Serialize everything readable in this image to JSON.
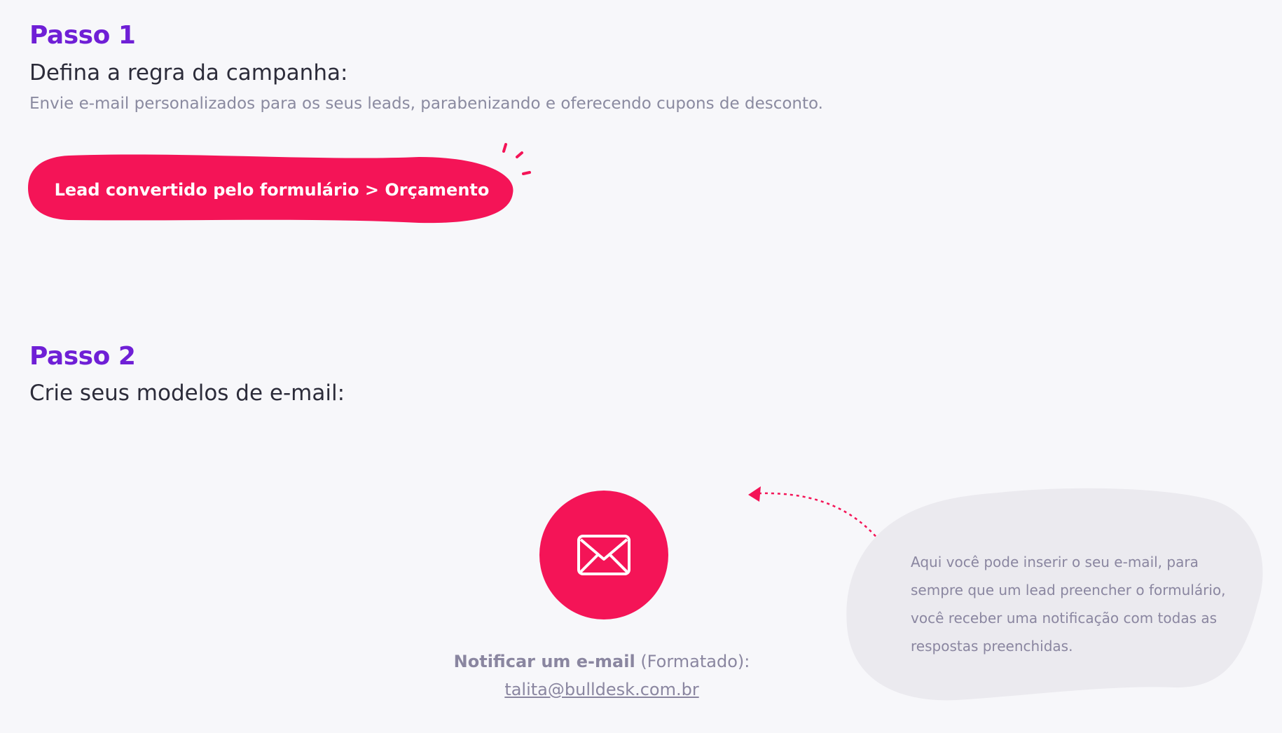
{
  "step1": {
    "title": "Passo 1",
    "subtitle": "Defina a regra da campanha:",
    "description": "Envie e-mail personalizados para os seus leads, parabenizando e oferecendo cupons de desconto.",
    "rule_label": "Lead convertido pelo formulário > Orçamento"
  },
  "step2": {
    "title": "Passo 2",
    "subtitle": "Crie seus modelos de e-mail:"
  },
  "notify": {
    "icon": "envelope-icon",
    "label_bold": "Notificar um e-mail",
    "label_rest": " (Formatado):",
    "email": "talita@bulldesk.com.br"
  },
  "tip": {
    "text": "Aqui você pode inserir o seu e-mail, para sempre que um lead preencher o formulário, você receber uma notificação com todas as respostas preenchidas."
  },
  "colors": {
    "accent_purple": "#6f1fd6",
    "accent_pink": "#f41457",
    "background": "#f7f7fa",
    "tip_bubble": "#ebeaef"
  }
}
